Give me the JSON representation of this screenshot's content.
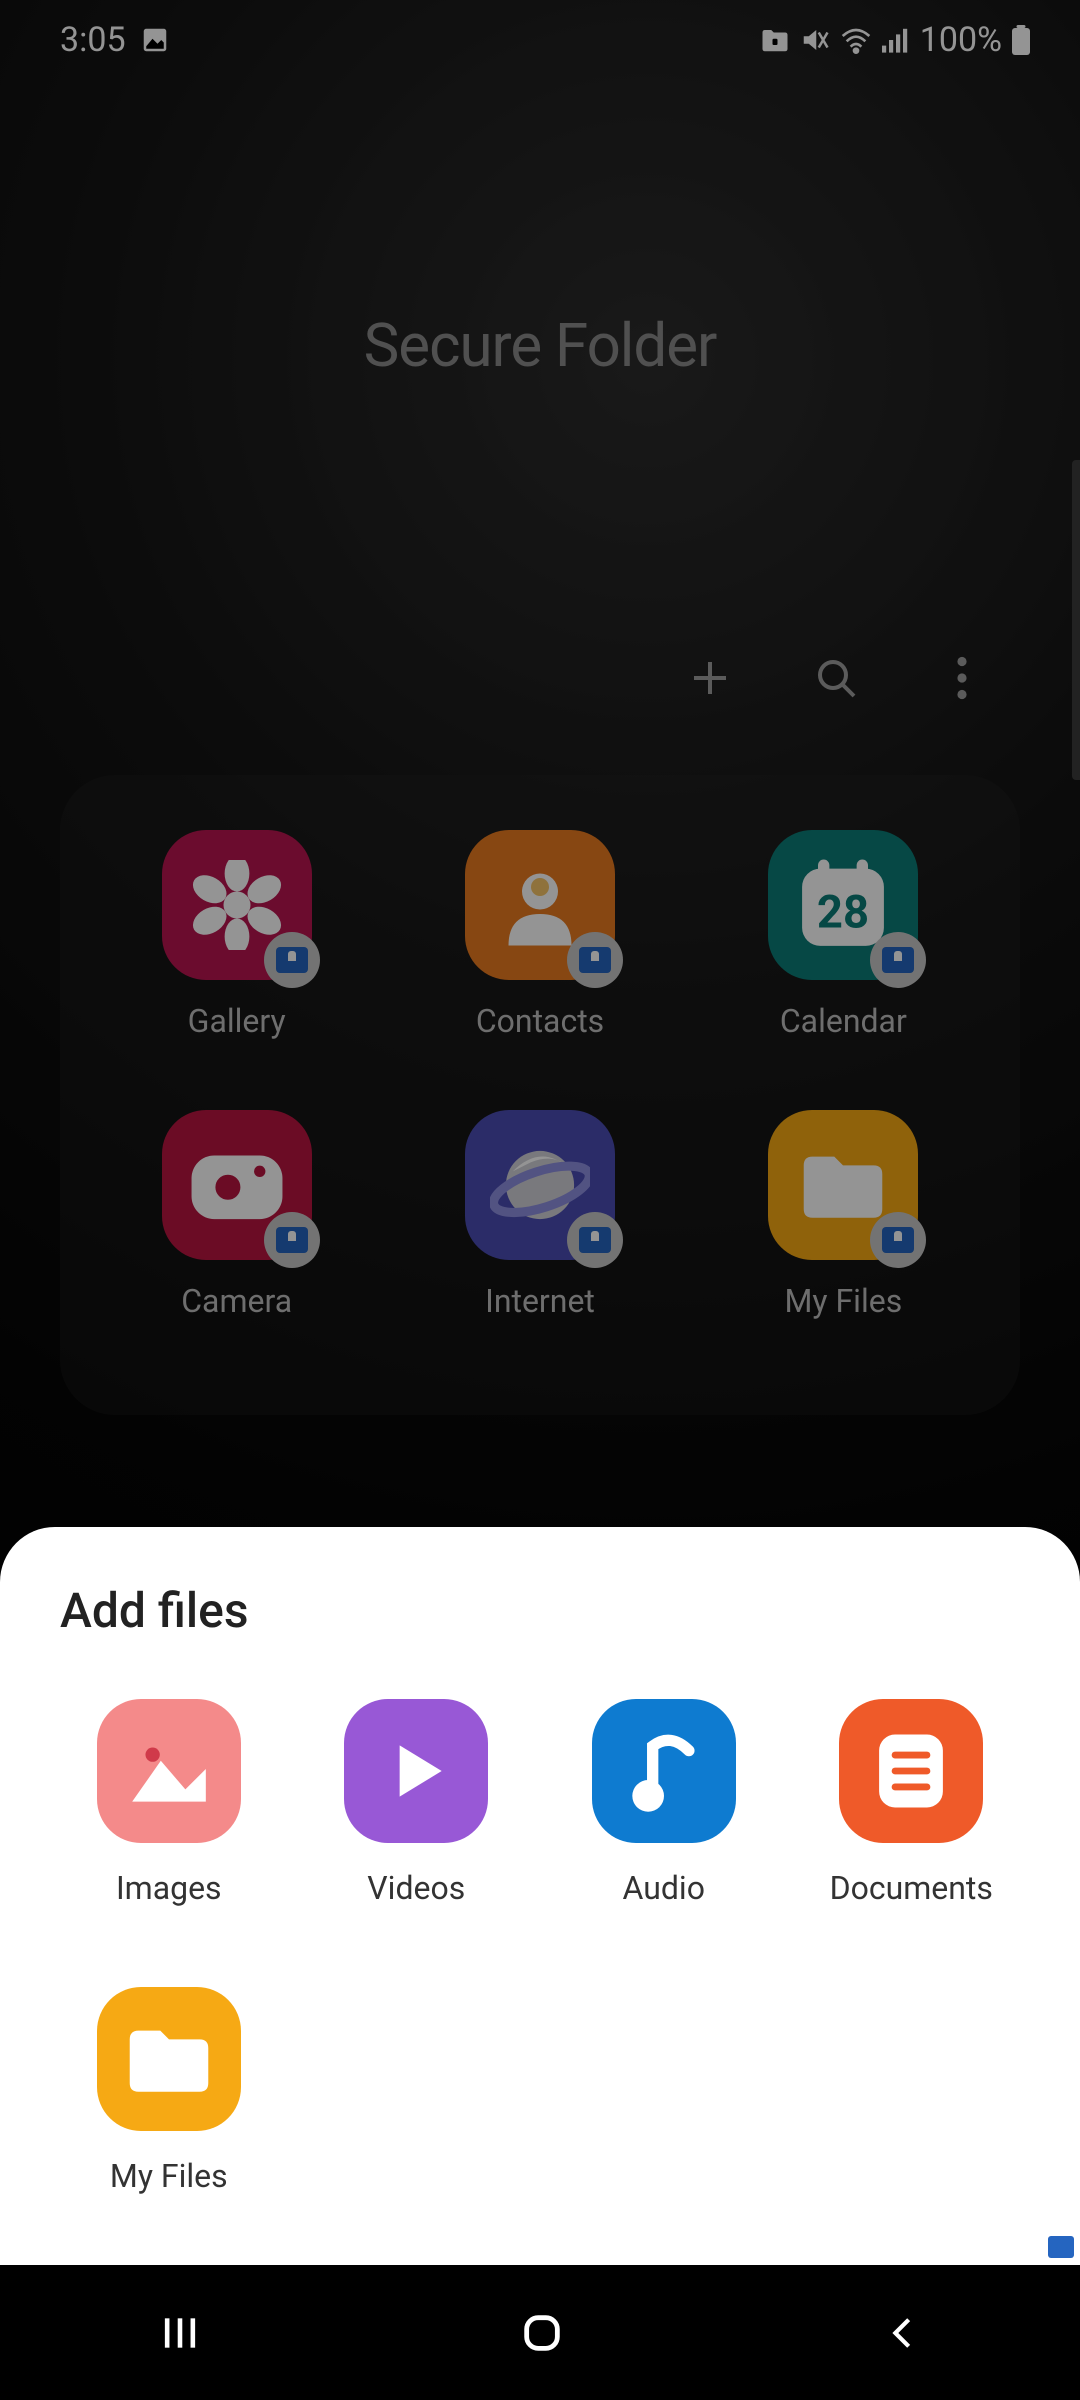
{
  "status": {
    "time": "3:05",
    "battery": "100%"
  },
  "header": {
    "title": "Secure Folder"
  },
  "apps": [
    {
      "label": "Gallery",
      "bg": "#b91650",
      "icon": "flower"
    },
    {
      "label": "Contacts",
      "bg": "#e87a1f",
      "icon": "contact"
    },
    {
      "label": "Calendar",
      "bg": "#0b7d78",
      "icon": "calendar",
      "day": "28"
    },
    {
      "label": "Camera",
      "bg": "#b91641",
      "icon": "camera"
    },
    {
      "label": "Internet",
      "bg": "#4b4db3",
      "icon": "planet"
    },
    {
      "label": "My Files",
      "bg": "#f6a914",
      "icon": "folder"
    }
  ],
  "sheet": {
    "title": "Add files",
    "items": [
      {
        "label": "Images",
        "bg": "#f48a8a",
        "icon": "image"
      },
      {
        "label": "Videos",
        "bg": "#9858d6",
        "icon": "play"
      },
      {
        "label": "Audio",
        "bg": "#0e7bd0",
        "icon": "note"
      },
      {
        "label": "Documents",
        "bg": "#ef5a29",
        "icon": "doc"
      },
      {
        "label": "My Files",
        "bg": "#f6a914",
        "icon": "folder"
      }
    ]
  }
}
